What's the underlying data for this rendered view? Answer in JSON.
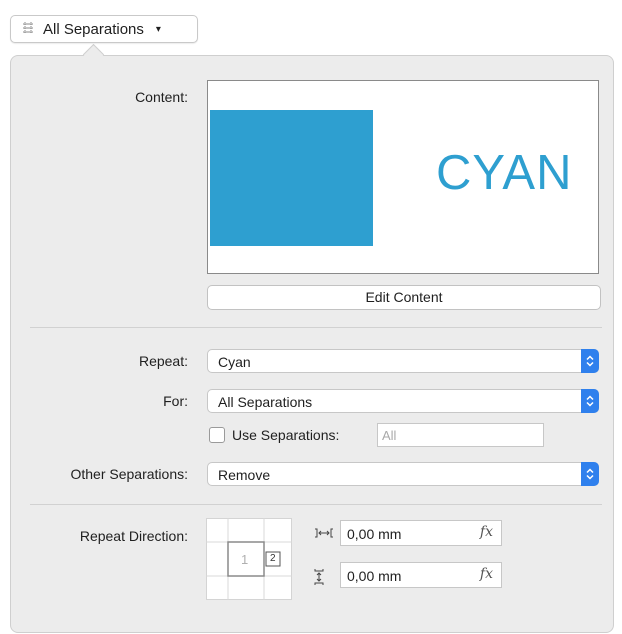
{
  "top_popup": {
    "label": "All Separations",
    "icon": "separations-icon",
    "caret": "▾"
  },
  "content": {
    "label": "Content:",
    "preview_text": "CYAN",
    "preview_color": "#2e9fd0",
    "edit_button": "Edit Content"
  },
  "repeat": {
    "label": "Repeat:",
    "value": "Cyan"
  },
  "for": {
    "label": "For:",
    "value": "All Separations"
  },
  "use_separations": {
    "label": "Use Separations:",
    "checked": false,
    "value": "All"
  },
  "other_separations": {
    "label": "Other Separations:",
    "value": "Remove"
  },
  "repeat_direction": {
    "label": "Repeat Direction:",
    "tile_primary": "1",
    "tile_secondary": "2",
    "horizontal": {
      "icon": "horizontal-spacing-icon",
      "value": "0,00 mm",
      "fx_label": "fx"
    },
    "vertical": {
      "icon": "vertical-spacing-icon",
      "value": "0,00 mm",
      "fx_label": "fx"
    }
  },
  "accent_color": "#2f80ed"
}
